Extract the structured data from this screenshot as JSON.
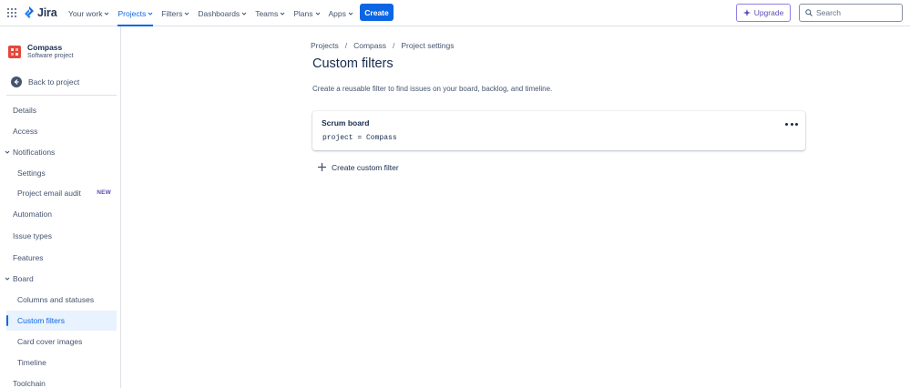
{
  "topbar": {
    "product": "Jira",
    "nav": [
      {
        "label": "Your work",
        "active": false
      },
      {
        "label": "Projects",
        "active": true
      },
      {
        "label": "Filters",
        "active": false
      },
      {
        "label": "Dashboards",
        "active": false
      },
      {
        "label": "Teams",
        "active": false
      },
      {
        "label": "Plans",
        "active": false
      },
      {
        "label": "Apps",
        "active": false
      }
    ],
    "create_label": "Create",
    "upgrade_label": "Upgrade",
    "search_placeholder": "Search",
    "accent_color": "#0c66e4"
  },
  "sidebar": {
    "project_name": "Compass",
    "project_type": "Software project",
    "back_label": "Back to project",
    "items": [
      {
        "label": "Details"
      },
      {
        "label": "Access"
      },
      {
        "label": "Notifications"
      },
      {
        "label": "Settings"
      },
      {
        "label": "Project email audit",
        "badge": "NEW"
      },
      {
        "label": "Automation"
      },
      {
        "label": "Issue types"
      },
      {
        "label": "Features"
      },
      {
        "label": "Board"
      },
      {
        "label": "Columns and statuses"
      },
      {
        "label": "Custom filters"
      },
      {
        "label": "Card cover images"
      },
      {
        "label": "Timeline"
      },
      {
        "label": "Toolchain"
      }
    ]
  },
  "main": {
    "breadcrumb": [
      "Projects",
      "Compass",
      "Project settings"
    ],
    "title": "Custom filters",
    "description": "Create a reusable filter to find issues on your board, backlog, and timeline.",
    "filters": [
      {
        "name": "Scrum board",
        "query": "project = Compass"
      }
    ],
    "create_filter_label": "Create custom filter"
  }
}
